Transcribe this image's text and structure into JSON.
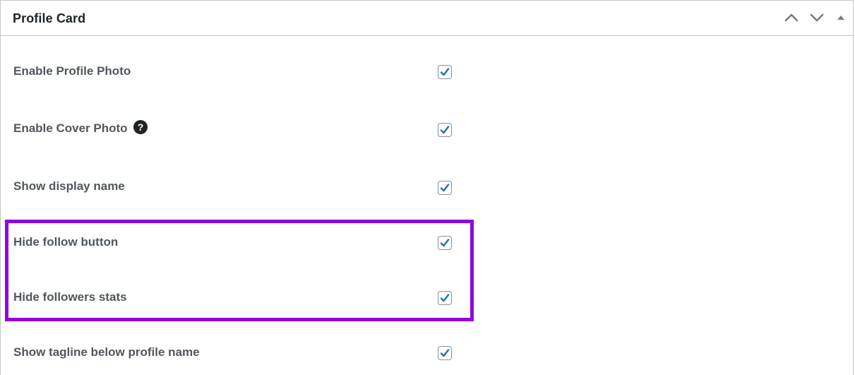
{
  "panel": {
    "title": "Profile Card",
    "actions": [
      {
        "name": "move-up",
        "icon": "chevron-up-icon"
      },
      {
        "name": "move-down",
        "icon": "chevron-down-icon"
      },
      {
        "name": "toggle-panel",
        "icon": "triangle-up-icon"
      }
    ]
  },
  "settings": [
    {
      "label": "Enable Profile Photo",
      "checked": true
    },
    {
      "label": "Enable Cover Photo",
      "checked": true,
      "help_icon": "question-circle-icon"
    },
    {
      "label": "Show display name",
      "checked": true
    },
    {
      "label": "Hide follow button",
      "checked": true
    },
    {
      "label": "Hide followers stats",
      "checked": true
    },
    {
      "label": "Show tagline below profile name",
      "checked": true
    }
  ],
  "colors": {
    "checkmark": "#2271b1",
    "highlight": "#8e08dc",
    "label": "#50575e",
    "title": "#1d2327"
  }
}
